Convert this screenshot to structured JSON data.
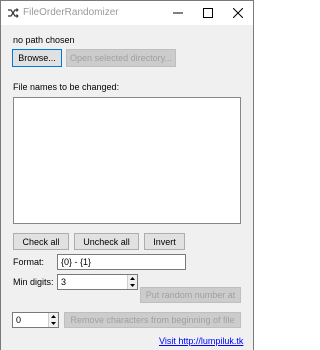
{
  "window": {
    "title": "FileOrderRandomizer",
    "icon": "shuffle-icon",
    "controls": [
      "minimize-icon",
      "maximize-icon",
      "close-icon"
    ]
  },
  "path": {
    "status_text": "no path chosen",
    "browse_label": "Browse...",
    "open_dir_label": "Open selected directory..."
  },
  "files": {
    "heading": "File names to be changed:",
    "items": []
  },
  "selection": {
    "check_all_label": "Check all",
    "uncheck_all_label": "Uncheck all",
    "invert_label": "Invert"
  },
  "format": {
    "label": "Format:",
    "value": "{0} - {1}"
  },
  "min_digits": {
    "label": "Min digits:",
    "value": "3"
  },
  "actions": {
    "put_random_label": "Put random number at",
    "remove_chars_value": "0",
    "remove_chars_label": "Remove characters from beginning of file"
  },
  "footer": {
    "link_text": "Visit http://lumpiluk.tk"
  },
  "colors": {
    "window_bg": "#f0f0f0",
    "button_bg": "#e1e1e1",
    "disabled_bg": "#cccccc",
    "focus_border": "#0078d7",
    "link": "#0000ff"
  }
}
